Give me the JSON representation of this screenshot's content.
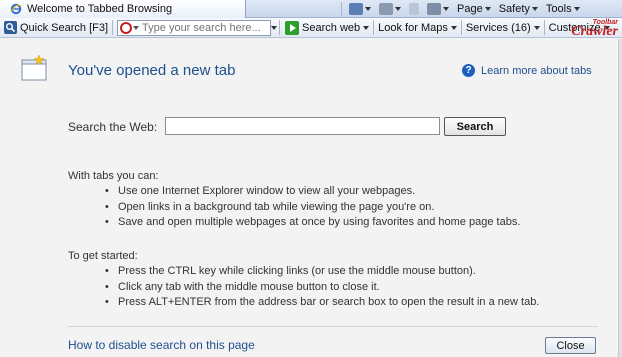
{
  "tab": {
    "title": "Welcome to Tabbed Browsing"
  },
  "command_bar": {
    "page_label": "Page",
    "safety_label": "Safety",
    "tools_label": "Tools"
  },
  "toolbar": {
    "quick_search_label": "Quick Search [F3]",
    "search_placeholder": "Type your search here...",
    "search_web_label": "Search web",
    "look_for_maps_label": "Look for Maps",
    "services_label": "Services (16)",
    "customize_label": "Customize",
    "logo_small": "Toolbar",
    "logo_big": "Crawler"
  },
  "main": {
    "title": "You've opened a new tab",
    "help_link": "Learn more about tabs",
    "search_label": "Search the Web:",
    "search_value": "",
    "search_button": "Search",
    "with_tabs_heading": "With tabs you can:",
    "with_tabs_items": [
      "Use one Internet Explorer window to view all your webpages.",
      "Open links in a background tab while viewing the page you're on.",
      "Save and open multiple webpages at once by using favorites and home page tabs."
    ],
    "get_started_heading": "To get started:",
    "get_started_items": [
      "Press the CTRL key while clicking links (or use the middle mouse button).",
      "Click any tab with the middle mouse button to close it.",
      "Press ALT+ENTER from the address bar or search box to open the result in a new tab."
    ],
    "disable_link": "How to disable search on this page",
    "close_button": "Close"
  },
  "colors": {
    "link_blue": "#1f4f8f",
    "crawler_red": "#c31f1f",
    "go_green": "#2f9e2f"
  }
}
